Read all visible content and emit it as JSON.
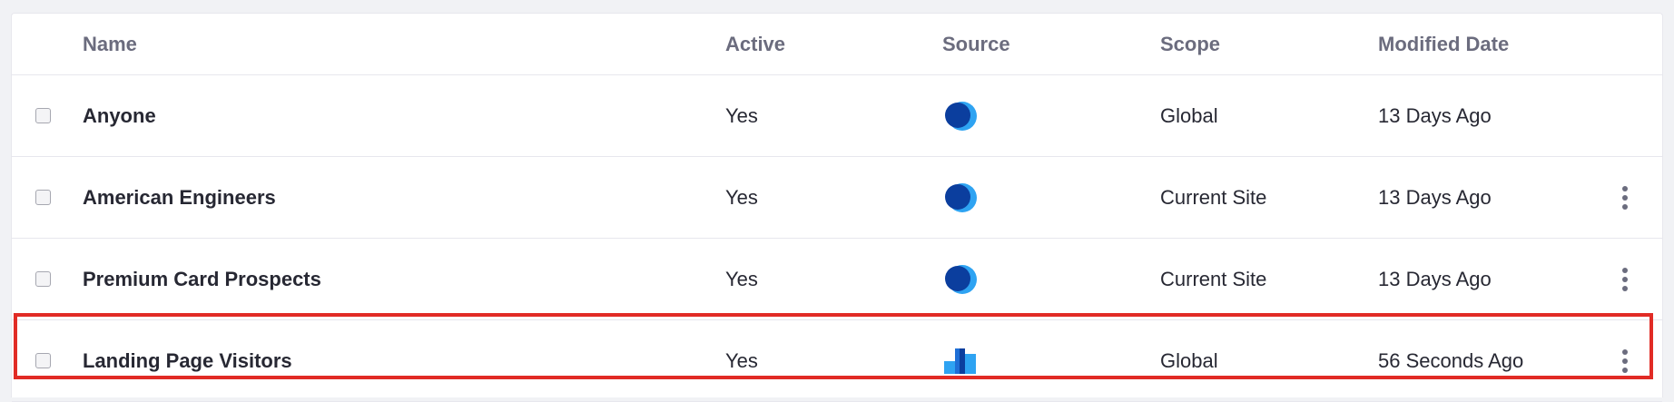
{
  "table": {
    "headers": {
      "name": "Name",
      "active": "Active",
      "source": "Source",
      "scope": "Scope",
      "modified": "Modified Date"
    },
    "rows": [
      {
        "name": "Anyone",
        "active": "Yes",
        "source_icon": "liferay-drop-icon",
        "scope": "Global",
        "modified": "13 Days Ago",
        "has_actions": false,
        "highlighted": false
      },
      {
        "name": "American Engineers",
        "active": "Yes",
        "source_icon": "liferay-drop-icon",
        "scope": "Current Site",
        "modified": "13 Days Ago",
        "has_actions": true,
        "highlighted": false
      },
      {
        "name": "Premium Card Prospects",
        "active": "Yes",
        "source_icon": "liferay-drop-icon",
        "scope": "Current Site",
        "modified": "13 Days Ago",
        "has_actions": true,
        "highlighted": false
      },
      {
        "name": "Landing Page Visitors",
        "active": "Yes",
        "source_icon": "analytics-cloud-icon",
        "scope": "Global",
        "modified": "56 Seconds Ago",
        "has_actions": true,
        "highlighted": true
      }
    ]
  },
  "colors": {
    "highlight_border": "#e12b25",
    "header_text": "#6b6c7e",
    "body_text": "#272833",
    "icon_dark": "#0b3e9e",
    "icon_light": "#2ea3f2"
  }
}
